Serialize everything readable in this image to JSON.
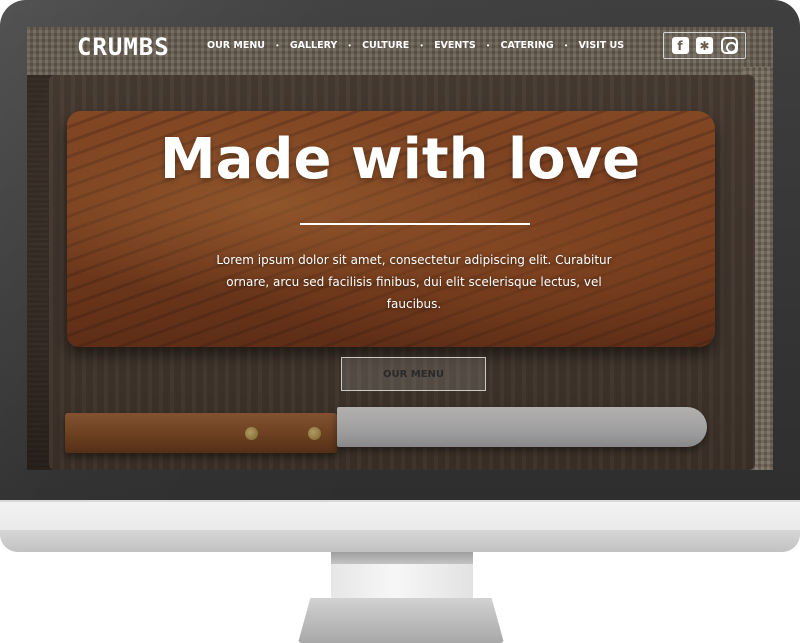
{
  "site": {
    "logo": "CRUMBS",
    "nav": [
      {
        "label": "OUR MENU"
      },
      {
        "label": "GALLERY"
      },
      {
        "label": "CULTURE"
      },
      {
        "label": "EVENTS"
      },
      {
        "label": "CATERING"
      },
      {
        "label": "VISIT US"
      }
    ],
    "nav_separator": "•",
    "social": [
      {
        "icon": "facebook-icon",
        "glyph": "f"
      },
      {
        "icon": "yelp-icon",
        "glyph": "✱"
      },
      {
        "icon": "instagram-icon",
        "glyph": ""
      }
    ]
  },
  "hero": {
    "title": "Made with love",
    "text": "Lorem ipsum dolor sit amet, consectetur adipiscing elit. Curabitur ornare, arcu sed facilisis finibus, dui elit scelerisque lectus, vel faucibus.",
    "button_label": "OUR MENU"
  },
  "colors": {
    "text": "#ffffff",
    "button_text": "#2a2a2a",
    "monitor_frame": "#2e2e2e",
    "monitor_chin": "#e9e9e9"
  }
}
